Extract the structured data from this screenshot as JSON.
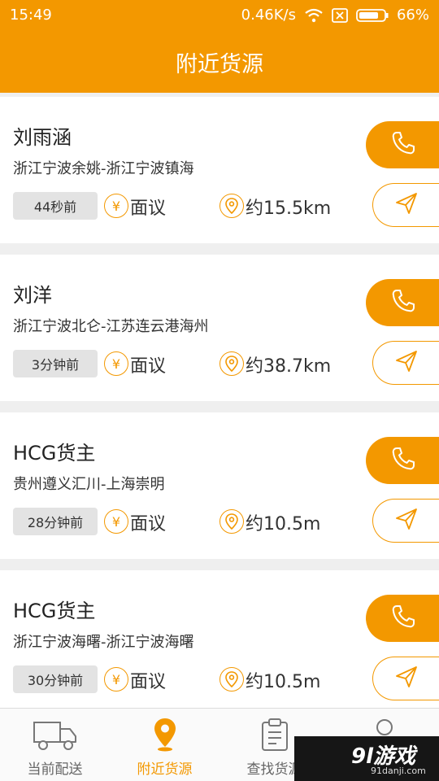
{
  "status": {
    "time": "15:49",
    "speed": "0.46K/s",
    "battery": "66%"
  },
  "header": {
    "title": "附近货源"
  },
  "colors": {
    "accent": "#f39800",
    "text": "#333333",
    "badge_bg": "#e3e3e3"
  },
  "currency_symbol": "¥",
  "cards": [
    {
      "name": "刘雨涵",
      "route": "浙江宁波余姚-浙江宁波镇海",
      "time": "44秒前",
      "price": "面议",
      "distance": "约15.5km"
    },
    {
      "name": "刘洋",
      "route": "浙江宁波北仑-江苏连云港海州",
      "time": "3分钟前",
      "price": "面议",
      "distance": "约38.7km"
    },
    {
      "name": "HCG货主",
      "route": "贵州遵义汇川-上海崇明",
      "time": "28分钟前",
      "price": "面议",
      "distance": "约10.5m"
    },
    {
      "name": "HCG货主",
      "route": "浙江宁波海曙-浙江宁波海曙",
      "time": "30分钟前",
      "price": "面议",
      "distance": "约10.5m"
    }
  ],
  "tabs": [
    {
      "label": "当前配送",
      "icon": "truck-icon",
      "active": false
    },
    {
      "label": "附近货源",
      "icon": "location-pin-icon",
      "active": true
    },
    {
      "label": "查找货源",
      "icon": "clipboard-icon",
      "active": false
    },
    {
      "label": "",
      "icon": "user-icon",
      "active": false
    }
  ],
  "watermark": {
    "logo": "9l游戏",
    "url": "91danji.com"
  }
}
